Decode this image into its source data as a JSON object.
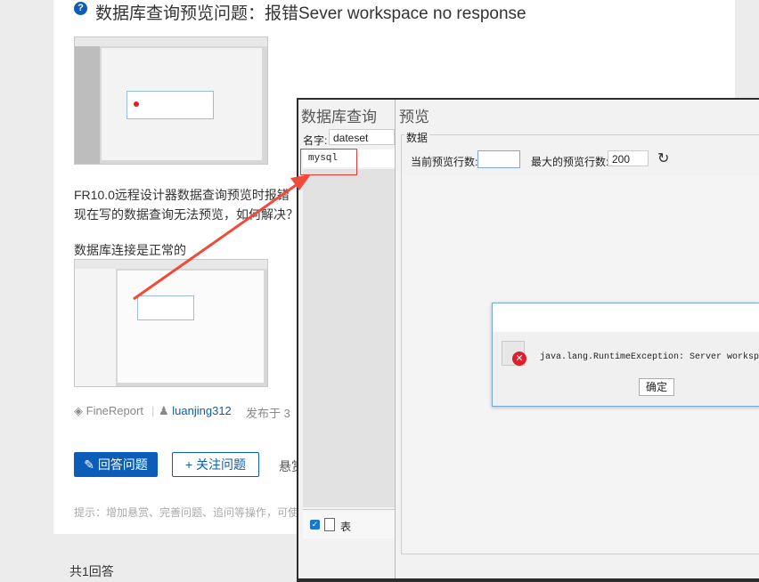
{
  "question": {
    "title": "数据库查询预览问题：报错Sever workspace no response",
    "body_line1": "FR10.0远程设计器数据查询预览时报错",
    "body_line2": "现在写的数据查询无法预览，如何解决？",
    "body_line3": "数据库连接是正常的",
    "product": "FineReport",
    "author": "luanjing312",
    "posted": "发布于 3",
    "answer_button": "回答问题",
    "follow_button": "关注问题",
    "more_text": "悬赏",
    "hint": "提示：增加悬赏、完善问题、追问等操作，可使",
    "answer_count": "共1回答"
  },
  "designer": {
    "left_title": "数据库查询",
    "name_label": "名字:",
    "name_value": "dateset",
    "connection": "mysql",
    "table_label": "表",
    "table_checked": true
  },
  "preview": {
    "title": "预览",
    "section_label": "数据",
    "current_rows_label": "当前预览行数:",
    "current_rows_value": "",
    "max_rows_label": "最大的预览行数:",
    "max_rows_value": "200"
  },
  "error_dialog": {
    "message": "java.lang.RuntimeException: Server workspace n",
    "ok_button": "确定"
  },
  "colors": {
    "brand": "#0b5db7",
    "annotation": "#e53935",
    "error": "#e11d2a"
  },
  "icons": [
    "question-icon",
    "refresh-icon",
    "error-icon",
    "table-icon",
    "tag-icon",
    "user-icon",
    "pencil-icon",
    "plus-icon"
  ]
}
